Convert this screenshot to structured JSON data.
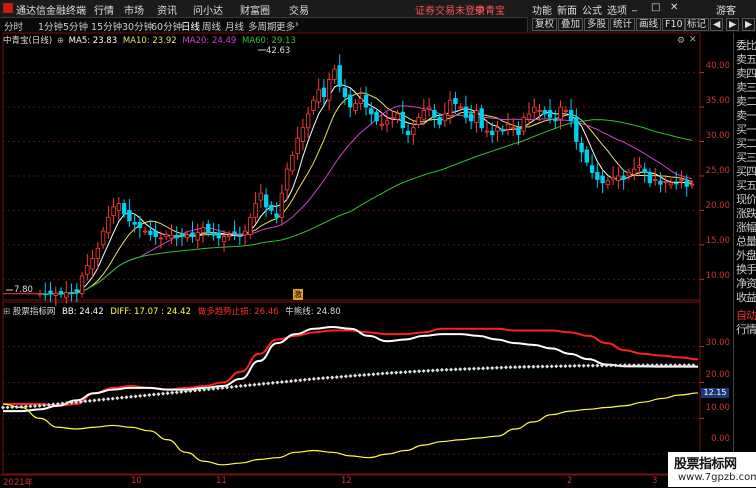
{
  "topbar": {
    "app_title": "通达信金融终端",
    "menus": [
      "行情",
      "市场",
      "资讯",
      "问小达",
      "财富圈",
      "交易"
    ],
    "login_status": "证券交易未登录",
    "stock_name": "中青宝",
    "right_menus": [
      "功能",
      "新面",
      "公式",
      "选项"
    ],
    "user": "游客"
  },
  "periods": [
    "分时",
    "1分钟",
    "5分钟",
    "15分钟",
    "30分钟",
    "60分钟",
    "日线",
    "周线",
    "月线",
    "多周期",
    "更多"
  ],
  "active_period": "日线",
  "toolbar_right": [
    "复权",
    "叠加",
    "多股",
    "统计",
    "画线",
    "F10",
    "标记"
  ],
  "sidebar": {
    "top": [
      "委比",
      "卖五",
      "卖四",
      "卖三",
      "卖二",
      "卖一",
      "买一",
      "买二",
      "买三",
      "买四",
      "买五",
      "现价",
      "涨跌",
      "涨幅",
      "总量",
      "外盘",
      "换手",
      "净资",
      "收益"
    ],
    "bottom": [
      "自动",
      "行情"
    ]
  },
  "main_legend": {
    "title": "中青宝(日线)",
    "ma5": "MA5: 23.83",
    "ma10": "MA10: 23.92",
    "ma20": "MA20: 24.49",
    "ma60": "MA60: 29.13"
  },
  "indicator_legend": {
    "title": "股票指标网",
    "bb": "BB: 24.42",
    "diff": "DIFF: 17.07 : 24.42",
    "signal": "做多趋势止损: 26.46",
    "bull": "牛熊线: 24.80"
  },
  "annotations": {
    "high": "42.63",
    "low": "7.80",
    "mark": "激"
  },
  "y_axis_main": [
    "40.00",
    "35.00",
    "30.00",
    "25.00",
    "20.00",
    "15.00",
    "10.00"
  ],
  "y_axis_ind": [
    "30.00",
    "20.00",
    "10.00",
    "0.00"
  ],
  "x_axis": [
    "2021年",
    "10",
    "11",
    "12",
    "2",
    "3"
  ],
  "current_value_tag": "12.15",
  "watermark": {
    "title": "股票指标网",
    "url": "www.7gpzb.com"
  },
  "colors": {
    "up": "#ff3b3b",
    "down": "#00d0f0",
    "ma5": "#ffffff",
    "ma10": "#e8e060",
    "ma20": "#d040d0",
    "ma60": "#30c030",
    "bb": "#ff2020",
    "diff": "#ffffff",
    "signal": "#ffff40"
  },
  "chart_data": [
    {
      "type": "candlestick",
      "title": "中青宝(日线)",
      "x_labels": [
        "2021年",
        "10",
        "11",
        "12",
        "2",
        "3"
      ],
      "ylim": [
        7,
        44
      ],
      "closes": [
        7.9,
        7.8,
        7.9,
        8.0,
        7.9,
        8.1,
        8.0,
        8.2,
        10.5,
        12.0,
        13.0,
        14.5,
        17.0,
        19.0,
        20.5,
        21.0,
        19.5,
        18.5,
        18.0,
        17.5,
        17.0,
        16.5,
        16.2,
        16.0,
        16.5,
        16.4,
        16.0,
        16.3,
        16.5,
        16.2,
        16.8,
        17.5,
        16.8,
        16.5,
        16.0,
        16.2,
        16.4,
        16.6,
        16.2,
        17.0,
        19.0,
        21.0,
        22.5,
        20.5,
        20.0,
        19.0,
        22.5,
        26.0,
        28.0,
        30.5,
        32.0,
        34.0,
        36.0,
        37.5,
        36.5,
        39.0,
        40.5,
        38.0,
        36.5,
        35.0,
        35.5,
        36.2,
        35.0,
        34.0,
        33.0,
        32.5,
        33.0,
        33.5,
        34.0,
        32.0,
        31.0,
        32.0,
        33.5,
        34.5,
        35.0,
        33.5,
        32.5,
        34.0,
        36.0,
        35.5,
        35.0,
        33.5,
        33.0,
        34.5,
        32.0,
        31.5,
        31.0,
        32.0,
        31.5,
        32.5,
        32.0,
        31.0,
        33.5,
        34.0,
        35.0,
        34.5,
        34.0,
        33.5,
        33.0,
        35.0,
        34.5,
        33.0,
        30.0,
        28.5,
        27.0,
        25.5,
        24.5,
        24.0,
        24.3,
        24.8,
        25.0,
        24.5,
        25.5,
        26.0,
        26.5,
        25.5,
        24.0,
        24.5,
        23.8,
        24.2,
        24.0,
        23.9,
        24.5,
        23.5,
        23.8
      ],
      "series": [
        {
          "name": "MA5",
          "values": [
            23.83
          ]
        },
        {
          "name": "MA10",
          "values": [
            23.92
          ]
        },
        {
          "name": "MA20",
          "values": [
            24.49
          ]
        },
        {
          "name": "MA60",
          "values": [
            29.13
          ]
        }
      ]
    },
    {
      "type": "line",
      "title": "股票指标网",
      "ylim": [
        -5,
        38
      ],
      "series": [
        {
          "name": "BB",
          "values": [
            14.0,
            14.0,
            14.0,
            13.5,
            14.0,
            17.0,
            18.5,
            19.0,
            18.5,
            18.0,
            18.5,
            19.0,
            20.0,
            23.0,
            28.0,
            32.0,
            33.0,
            34.0,
            34.5,
            34.5,
            34.0,
            33.5,
            33.5,
            34.0,
            35.0,
            35.0,
            35.0,
            35.0,
            34.5,
            34.5,
            34.5,
            34.0,
            33.0,
            31.0,
            29.0,
            28.0,
            27.5,
            27.0,
            26.46
          ]
        },
        {
          "name": "DIFF",
          "values": [
            12.0,
            12.0,
            12.5,
            13.5,
            15.0,
            17.0,
            18.0,
            18.5,
            18.5,
            18.0,
            18.0,
            18.5,
            19.0,
            21.0,
            26.0,
            31.0,
            33.5,
            35.0,
            35.5,
            35.0,
            33.0,
            31.5,
            32.0,
            33.0,
            33.5,
            33.5,
            33.0,
            32.0,
            31.0,
            30.5,
            29.5,
            28.0,
            26.5,
            25.0,
            24.5,
            24.5,
            24.42,
            24.42,
            24.42
          ]
        },
        {
          "name": "牛熊线",
          "values": [
            13.0,
            13.2,
            13.5,
            14.0,
            14.5,
            15.0,
            15.5,
            16.0,
            16.5,
            17.0,
            17.5,
            18.0,
            18.5,
            19.0,
            19.5,
            20.0,
            20.5,
            21.0,
            21.4,
            21.8,
            22.2,
            22.6,
            22.9,
            23.2,
            23.5,
            23.7,
            23.9,
            24.1,
            24.3,
            24.4,
            24.5,
            24.6,
            24.7,
            24.75,
            24.8,
            24.8,
            24.8,
            24.8,
            24.8
          ]
        },
        {
          "name": "做多趋势止损",
          "values": [
            14.0,
            13.0,
            10.0,
            7.5,
            7.0,
            7.5,
            8.0,
            7.5,
            6.5,
            4.0,
            0.5,
            -2.0,
            -3.0,
            -2.5,
            -1.5,
            -1.0,
            0.5,
            1.0,
            0.5,
            -0.5,
            -1.0,
            0.0,
            1.0,
            2.5,
            3.5,
            4.0,
            4.5,
            5.0,
            7.0,
            9.0,
            11.0,
            12.0,
            12.5,
            13.0,
            13.5,
            14.5,
            15.5,
            16.5,
            17.07
          ]
        }
      ]
    }
  ]
}
